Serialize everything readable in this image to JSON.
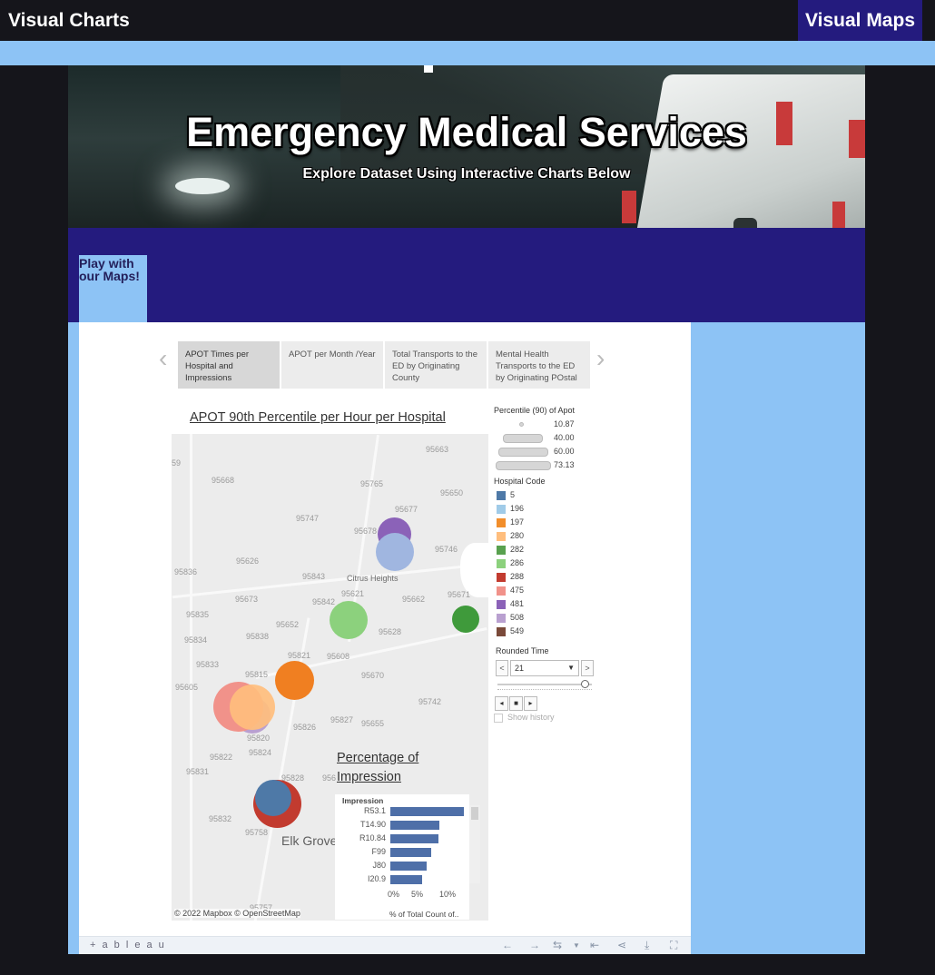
{
  "nav": {
    "left": "Visual Charts",
    "right": "Visual Maps"
  },
  "hero": {
    "title": "Emergency Medical Services",
    "subtitle": "Explore Dataset Using Interactive Charts Below"
  },
  "play_button": "Play with our Maps!",
  "tabs": [
    "APOT Times per Hospital and Impressions",
    "APOT per Month /Year",
    "Total Transports to the ED by Originating County",
    "Mental Health Transports to the ED by Originating POstal"
  ],
  "chart": {
    "title": "APOT 90th Percentile per Hour per Hospital ",
    "copyright": "© 2022 Mapbox  © OpenStreetMap",
    "zips": [
      "59",
      "95668",
      "95765",
      "95663",
      "95650",
      "95677",
      "95747",
      "95678",
      "95746",
      "95626",
      "95836",
      "95843",
      "95621",
      "95673",
      "95842",
      "95662",
      "95671",
      "95835",
      "95652",
      "95838",
      "95628",
      "95834",
      "95821",
      "95608",
      "95833",
      "95815",
      "95670",
      "95605",
      "95742",
      "95820",
      "95826",
      "95827",
      "95655",
      "95824",
      "95822",
      "95828",
      "95831",
      "95832",
      "95758",
      "95757",
      "956"
    ],
    "cities": [
      "Citrus Heights"
    ],
    "big_city": "Elk Grove"
  },
  "legend": {
    "size_title": "Percentile (90) of Apot",
    "sizes": [
      "10.87",
      "40.00",
      "60.00",
      "73.13"
    ],
    "color_title": "Hospital Code",
    "hospitals": [
      {
        "code": "5",
        "color": "#4e79a7"
      },
      {
        "code": "196",
        "color": "#a0cbe8"
      },
      {
        "code": "197",
        "color": "#f28e2b"
      },
      {
        "code": "280",
        "color": "#ffbe7d"
      },
      {
        "code": "282",
        "color": "#59a14f"
      },
      {
        "code": "286",
        "color": "#8cd17d"
      },
      {
        "code": "288",
        "color": "#c23b2f"
      },
      {
        "code": "475",
        "color": "#f1928a"
      },
      {
        "code": "481",
        "color": "#8b62b8"
      },
      {
        "code": "508",
        "color": "#b9a0d0"
      },
      {
        "code": "549",
        "color": "#7a4a3a"
      }
    ]
  },
  "rounded_time": {
    "title": "Rounded Time",
    "value": "21",
    "show_history": "Show history"
  },
  "impression": {
    "title": "Percentage of Impression",
    "header": "Impression",
    "axis_title": "% of Total Count of..",
    "ticks": [
      "0%",
      "5%",
      "10%"
    ],
    "chart_data": {
      "type": "bar",
      "categories": [
        "R53.1",
        "T14.90",
        "R10.84",
        "F99",
        "J80",
        "I20.9"
      ],
      "values": [
        13.0,
        8.7,
        8.5,
        7.2,
        6.5,
        5.6
      ],
      "xlabel": "% of Total Count of..",
      "ylabel": "Impression",
      "xlim": [
        0,
        13.5
      ]
    }
  },
  "toolbar": {
    "logo": "+ a b l e a u"
  }
}
